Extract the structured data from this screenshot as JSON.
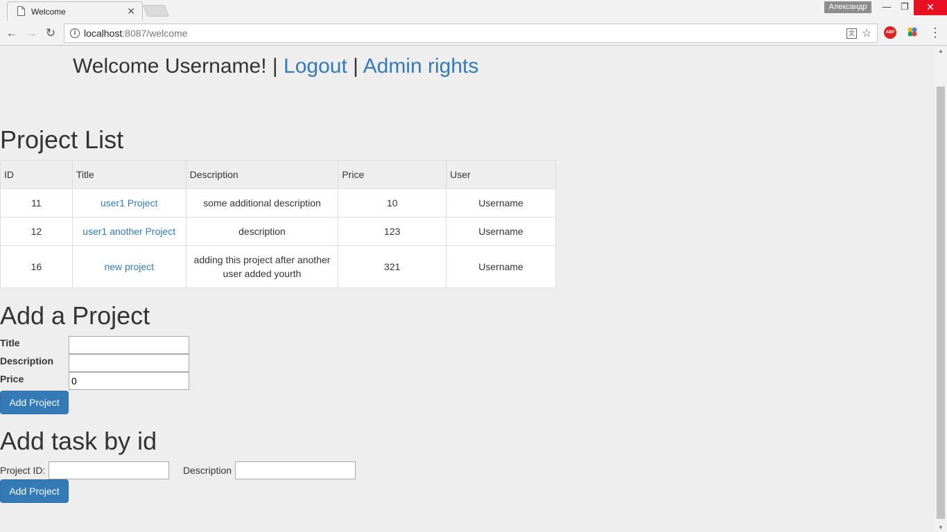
{
  "browser": {
    "tab_title": "Welcome",
    "profile_name": "Александр",
    "url_host": "localhost",
    "url_path": ":8087/welcome",
    "abp_label": "ABP"
  },
  "header": {
    "welcome_text": "Welcome Username!",
    "separator": "|",
    "logout_label": "Logout",
    "admin_label": "Admin rights"
  },
  "project_list": {
    "heading": "Project List",
    "columns": [
      "ID",
      "Title",
      "Description",
      "Price",
      "User"
    ],
    "rows": [
      {
        "id": "11",
        "title": "user1 Project",
        "description": "some additional description",
        "price": "10",
        "user": "Username"
      },
      {
        "id": "12",
        "title": "user1 another Project",
        "description": "description",
        "price": "123",
        "user": "Username"
      },
      {
        "id": "16",
        "title": "new project",
        "description": "adding this project after another user added yourth",
        "price": "321",
        "user": "Username"
      }
    ]
  },
  "add_project": {
    "heading": "Add a Project",
    "title_label": "Title",
    "title_value": "",
    "description_label": "Description",
    "description_value": "",
    "price_label": "Price",
    "price_value": "0",
    "button_label": "Add Project"
  },
  "add_task": {
    "heading": "Add task by id",
    "project_id_label": "Project ID:",
    "project_id_value": "",
    "description_label": "Description",
    "description_value": "",
    "button_label": "Add Project"
  }
}
